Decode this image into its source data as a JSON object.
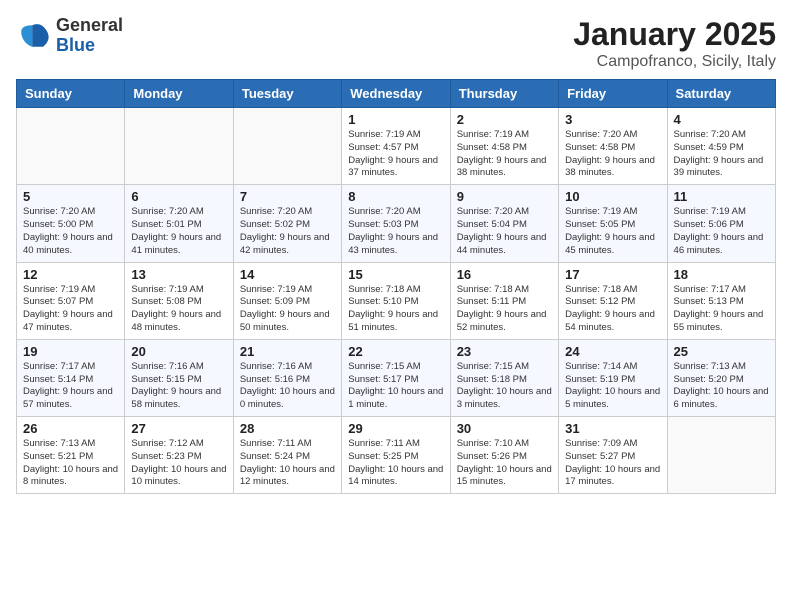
{
  "logo": {
    "general": "General",
    "blue": "Blue"
  },
  "title": "January 2025",
  "subtitle": "Campofranco, Sicily, Italy",
  "weekdays": [
    "Sunday",
    "Monday",
    "Tuesday",
    "Wednesday",
    "Thursday",
    "Friday",
    "Saturday"
  ],
  "weeks": [
    [
      {
        "day": "",
        "info": ""
      },
      {
        "day": "",
        "info": ""
      },
      {
        "day": "",
        "info": ""
      },
      {
        "day": "1",
        "info": "Sunrise: 7:19 AM\nSunset: 4:57 PM\nDaylight: 9 hours and 37 minutes."
      },
      {
        "day": "2",
        "info": "Sunrise: 7:19 AM\nSunset: 4:58 PM\nDaylight: 9 hours and 38 minutes."
      },
      {
        "day": "3",
        "info": "Sunrise: 7:20 AM\nSunset: 4:58 PM\nDaylight: 9 hours and 38 minutes."
      },
      {
        "day": "4",
        "info": "Sunrise: 7:20 AM\nSunset: 4:59 PM\nDaylight: 9 hours and 39 minutes."
      }
    ],
    [
      {
        "day": "5",
        "info": "Sunrise: 7:20 AM\nSunset: 5:00 PM\nDaylight: 9 hours and 40 minutes."
      },
      {
        "day": "6",
        "info": "Sunrise: 7:20 AM\nSunset: 5:01 PM\nDaylight: 9 hours and 41 minutes."
      },
      {
        "day": "7",
        "info": "Sunrise: 7:20 AM\nSunset: 5:02 PM\nDaylight: 9 hours and 42 minutes."
      },
      {
        "day": "8",
        "info": "Sunrise: 7:20 AM\nSunset: 5:03 PM\nDaylight: 9 hours and 43 minutes."
      },
      {
        "day": "9",
        "info": "Sunrise: 7:20 AM\nSunset: 5:04 PM\nDaylight: 9 hours and 44 minutes."
      },
      {
        "day": "10",
        "info": "Sunrise: 7:19 AM\nSunset: 5:05 PM\nDaylight: 9 hours and 45 minutes."
      },
      {
        "day": "11",
        "info": "Sunrise: 7:19 AM\nSunset: 5:06 PM\nDaylight: 9 hours and 46 minutes."
      }
    ],
    [
      {
        "day": "12",
        "info": "Sunrise: 7:19 AM\nSunset: 5:07 PM\nDaylight: 9 hours and 47 minutes."
      },
      {
        "day": "13",
        "info": "Sunrise: 7:19 AM\nSunset: 5:08 PM\nDaylight: 9 hours and 48 minutes."
      },
      {
        "day": "14",
        "info": "Sunrise: 7:19 AM\nSunset: 5:09 PM\nDaylight: 9 hours and 50 minutes."
      },
      {
        "day": "15",
        "info": "Sunrise: 7:18 AM\nSunset: 5:10 PM\nDaylight: 9 hours and 51 minutes."
      },
      {
        "day": "16",
        "info": "Sunrise: 7:18 AM\nSunset: 5:11 PM\nDaylight: 9 hours and 52 minutes."
      },
      {
        "day": "17",
        "info": "Sunrise: 7:18 AM\nSunset: 5:12 PM\nDaylight: 9 hours and 54 minutes."
      },
      {
        "day": "18",
        "info": "Sunrise: 7:17 AM\nSunset: 5:13 PM\nDaylight: 9 hours and 55 minutes."
      }
    ],
    [
      {
        "day": "19",
        "info": "Sunrise: 7:17 AM\nSunset: 5:14 PM\nDaylight: 9 hours and 57 minutes."
      },
      {
        "day": "20",
        "info": "Sunrise: 7:16 AM\nSunset: 5:15 PM\nDaylight: 9 hours and 58 minutes."
      },
      {
        "day": "21",
        "info": "Sunrise: 7:16 AM\nSunset: 5:16 PM\nDaylight: 10 hours and 0 minutes."
      },
      {
        "day": "22",
        "info": "Sunrise: 7:15 AM\nSunset: 5:17 PM\nDaylight: 10 hours and 1 minute."
      },
      {
        "day": "23",
        "info": "Sunrise: 7:15 AM\nSunset: 5:18 PM\nDaylight: 10 hours and 3 minutes."
      },
      {
        "day": "24",
        "info": "Sunrise: 7:14 AM\nSunset: 5:19 PM\nDaylight: 10 hours and 5 minutes."
      },
      {
        "day": "25",
        "info": "Sunrise: 7:13 AM\nSunset: 5:20 PM\nDaylight: 10 hours and 6 minutes."
      }
    ],
    [
      {
        "day": "26",
        "info": "Sunrise: 7:13 AM\nSunset: 5:21 PM\nDaylight: 10 hours and 8 minutes."
      },
      {
        "day": "27",
        "info": "Sunrise: 7:12 AM\nSunset: 5:23 PM\nDaylight: 10 hours and 10 minutes."
      },
      {
        "day": "28",
        "info": "Sunrise: 7:11 AM\nSunset: 5:24 PM\nDaylight: 10 hours and 12 minutes."
      },
      {
        "day": "29",
        "info": "Sunrise: 7:11 AM\nSunset: 5:25 PM\nDaylight: 10 hours and 14 minutes."
      },
      {
        "day": "30",
        "info": "Sunrise: 7:10 AM\nSunset: 5:26 PM\nDaylight: 10 hours and 15 minutes."
      },
      {
        "day": "31",
        "info": "Sunrise: 7:09 AM\nSunset: 5:27 PM\nDaylight: 10 hours and 17 minutes."
      },
      {
        "day": "",
        "info": ""
      }
    ]
  ]
}
